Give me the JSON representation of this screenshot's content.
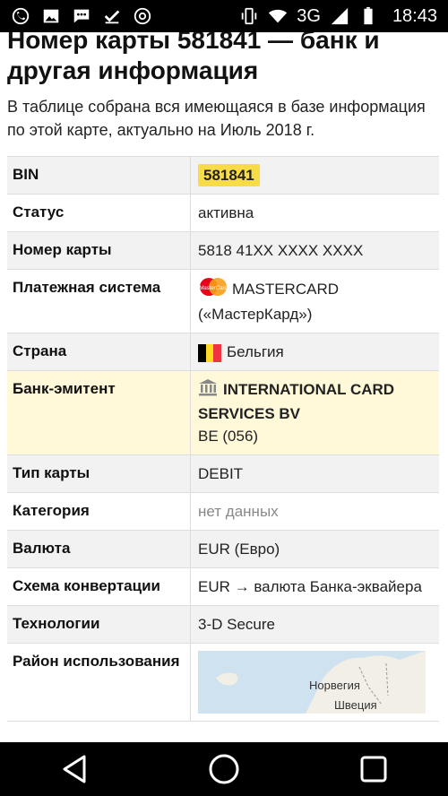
{
  "status_bar": {
    "network": "3G",
    "time": "18:43"
  },
  "page": {
    "title": "Номер карты 581841 — банк и другая информация",
    "intro": "В таблице собрана вся имеющаяся в базе информация по этой карте, актуально на Июль 2018 г."
  },
  "table": {
    "bin_label": "BIN",
    "bin_value": "581841",
    "status_label": "Статус",
    "status_value": "активна",
    "card_number_label": "Номер карты",
    "card_number_value": "5818 41XX XXXX XXXX",
    "payment_system_label": "Платежная система",
    "payment_system_name": "MASTERCARD",
    "payment_system_ru": "(«МастерКард»)",
    "mc_logo_text": "MasterCard",
    "country_label": "Страна",
    "country_value": "Бельгия",
    "bank_label": "Банк-эмитент",
    "bank_name": "INTERNATIONAL CARD SERVICES BV",
    "bank_code": "BE (056)",
    "card_type_label": "Тип карты",
    "card_type_value": "DEBIT",
    "category_label": "Категория",
    "category_value": "нет данных",
    "currency_label": "Валюта",
    "currency_value": "EUR (Евро)",
    "conversion_label": "Схема конвертации",
    "conversion_value": "EUR → валюта Банка-эквайера",
    "tech_label": "Технологии",
    "tech_value": "3-D Secure",
    "area_label": "Район использования",
    "map_label_norway": "Норвегия",
    "map_label_sweden": "Швеция"
  },
  "colors": {
    "bin_highlight": "#f8dc47",
    "bank_row": "#fff8d9",
    "shaded_row": "#f2f2f2",
    "flag_black": "#000000",
    "flag_yellow": "#fdda24",
    "flag_red": "#ef3340"
  },
  "icons": {
    "status_left": [
      "whatsapp-icon",
      "gallery-icon",
      "messages-icon",
      "checkmark-icon",
      "chrome-icon"
    ],
    "status_right": [
      "vibrate-icon",
      "wifi-icon",
      "signal-icon",
      "battery-icon"
    ],
    "nav": [
      "back-icon",
      "home-icon",
      "recents-icon"
    ]
  }
}
